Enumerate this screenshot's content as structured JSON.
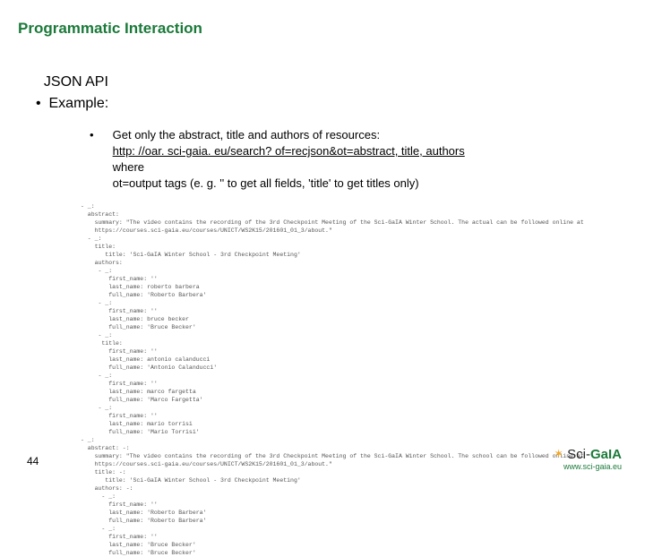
{
  "title": "Programmatic Interaction",
  "bullets": {
    "line1": "JSON API",
    "line2": "Example:"
  },
  "sub": {
    "line1": "Get only the abstract, title and authors of resources:",
    "link": "http: //oar. sci-gaia. eu/search? of=recjson&ot=abstract, title, authors",
    "line3": "where",
    "line4": "ot=output tags (e. g. '' to get all fields, 'title' to get titles only)"
  },
  "code": {
    "text": "- _:\n  abstract:\n    summary: \"The video contains the recording of the 3rd Checkpoint Meeting of the Sci-GaIA Winter School. The actual can be followed online at\n    https://courses.sci-gaia.eu/courses/UNICT/WS2K15/201601_01_3/about.\"\n  - _:\n    title:\n       title: 'Sci-GaIA Winter School - 3rd Checkpoint Meeting'\n    authors:\n     - _:\n        first_name: ''\n        last_name: roberto barbera\n        full_name: 'Roberto Barbera'\n     - _:\n        first_name: ''\n        last_name: bruce becker\n        full_name: 'Bruce Becker'\n     - _:\n      title:\n        first_name: ''\n        last_name: antonio calanducci\n        full_name: 'Antonio Calanducci'\n     - _:\n        first_name: ''\n        last_name: marco fargetta\n        full_name: 'Marco Fargetta'\n     - _:\n        first_name: ''\n        last_name: mario torrisi\n        full_name: 'Mario Torrisi'\n- _:\n  abstract: -:\n    summary: \"The video contains the recording of the 3rd Checkpoint Meeting of the Sci-GaIA Winter School. The school can be followed online at\n    https://courses.sci-gaia.eu/courses/UNICT/WS2K15/201601_01_3/about.\"\n    title: -:\n       title: 'Sci-GaIA Winter School - 3rd Checkpoint Meeting'\n    authors: -:\n      - _:\n        first_name: ''\n        last_name: 'Roberto Barbera'\n        full_name: 'Roberto Barbera'\n      - _:\n        first_name: ''\n        last_name: 'Bruce Becker'\n        full_name: 'Bruce Becker'"
  },
  "pagenum": "44",
  "logo": {
    "sci": "Sci",
    "dash": "-",
    "gal": "GaIA",
    "url": "www.sci-gaia.eu"
  }
}
